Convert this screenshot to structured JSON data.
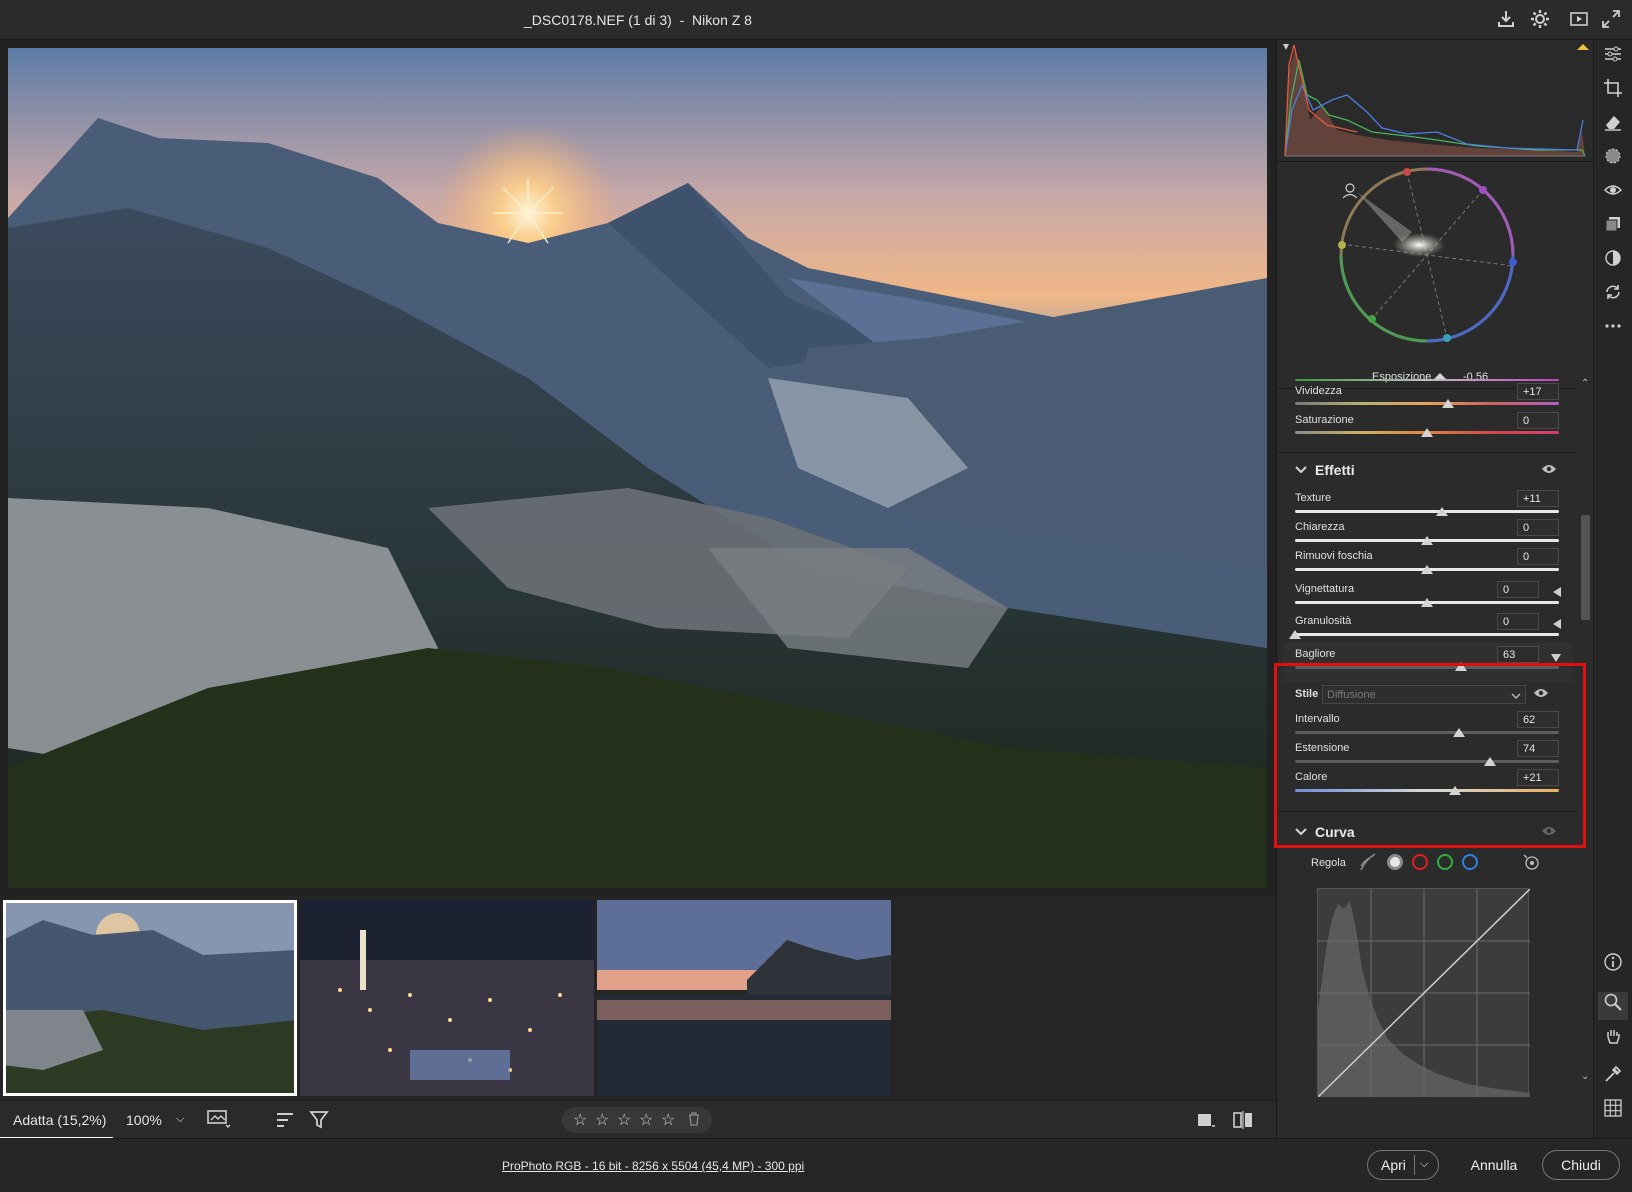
{
  "window": {
    "title": "_DSC0178.NEF (1 di 3)  -  Nikon Z 8",
    "icons": [
      "download-icon",
      "gear-icon",
      "play-icon",
      "expand-icon"
    ]
  },
  "filmstrip": {
    "thumbnails": [
      {
        "name": "mountain-sunset",
        "selected": true
      },
      {
        "name": "city-night",
        "selected": false
      },
      {
        "name": "lake-reflection",
        "selected": false
      }
    ]
  },
  "bottombar": {
    "zoom_fit": "Adatta (15,2%)",
    "zoom_100": "100%",
    "stars": [
      "☆",
      "☆",
      "☆",
      "☆",
      "☆"
    ]
  },
  "status": {
    "info": "ProPhoto RGB - 16 bit - 8256 x 5504 (45,4 MP) - 300 ppi",
    "open": "Apri",
    "cancel": "Annulla",
    "close": "Chiudi"
  },
  "panel": {
    "exposure": {
      "label": "Esposizione",
      "value": "-0,56"
    },
    "color": [
      {
        "label": "Vividezza",
        "value": "+17",
        "pos": 0.58
      },
      {
        "label": "Saturazione",
        "value": "0",
        "pos": 0.5
      }
    ],
    "effects": {
      "title": "Effetti",
      "sliders": [
        {
          "label": "Texture",
          "value": "+11",
          "pos": 0.555
        },
        {
          "label": "Chiarezza",
          "value": "0",
          "pos": 0.5
        },
        {
          "label": "Rimuovi foschia",
          "value": "0",
          "pos": 0.5
        },
        {
          "label": "Vignettatura",
          "value": "0",
          "pos": 0.5
        },
        {
          "label": "Granulosità",
          "value": "0",
          "pos": 0.0
        }
      ],
      "glow": {
        "label": "Bagliore",
        "value": "63",
        "pos": 0.63,
        "style_label": "Stile",
        "style_value": "Diffusione",
        "sub": [
          {
            "label": "Intervallo",
            "value": "62",
            "pos": 0.62
          },
          {
            "label": "Estensione",
            "value": "74",
            "pos": 0.74
          },
          {
            "label": "Calore",
            "value": "+21",
            "pos": 0.605
          }
        ]
      }
    },
    "curve": {
      "title": "Curva",
      "regola": "Regola"
    }
  },
  "colors": {
    "accent_red": "#e01010",
    "highlight_box": "#e01010"
  }
}
